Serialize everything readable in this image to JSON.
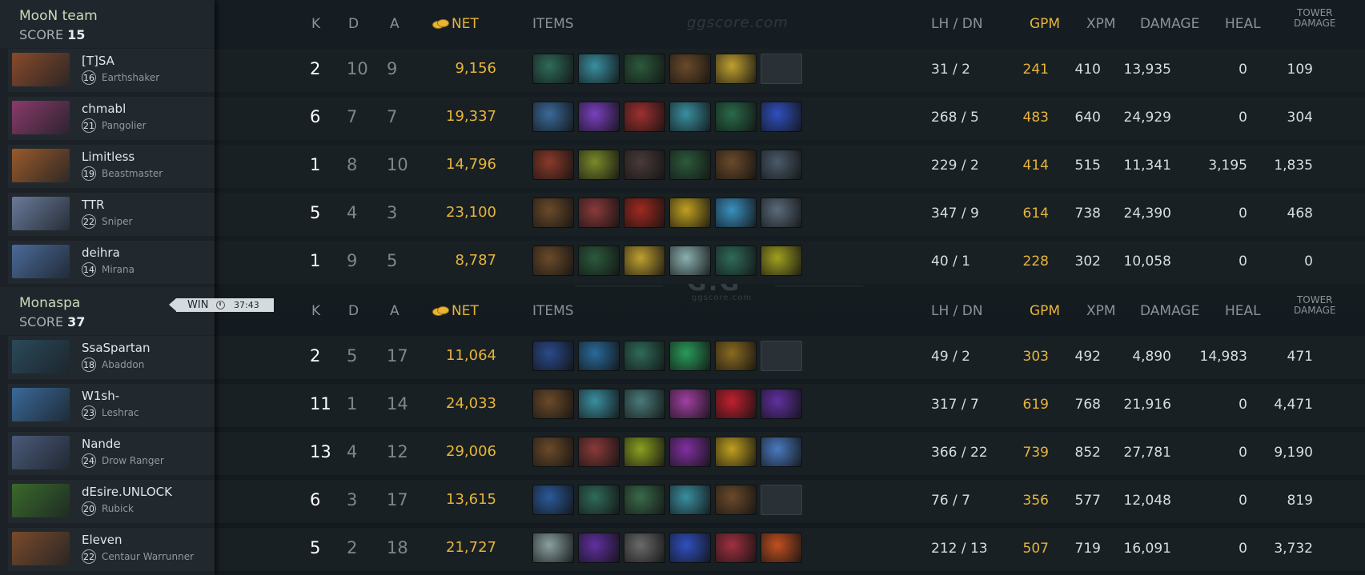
{
  "headers": {
    "k": "K",
    "d": "D",
    "a": "A",
    "net": "NET",
    "items": "ITEMS",
    "lhdn": "LH  /  DN",
    "gpm": "GPM",
    "xpm": "XPM",
    "damage": "DAMAGE",
    "heal": "HEAL",
    "tower_line1": "TOWER",
    "tower_line2": "DAMAGE"
  },
  "watermark": {
    "site": "ggscore.com",
    "logo": "G:G"
  },
  "result": {
    "label": "WIN",
    "time": "37:43"
  },
  "teams": [
    {
      "name": "MooN team",
      "score_label": "SCORE",
      "score": "15",
      "players": [
        {
          "name": "[T]SA",
          "level": "16",
          "hero": "Earthshaker",
          "k": "2",
          "d": "10",
          "a": "9",
          "net": "9,156",
          "lhdn": "31  /  2",
          "gpm": "241",
          "xpm": "410",
          "damage": "13,935",
          "heal": "0",
          "tower": "109",
          "portrait_color": "#8a4a2a",
          "items": [
            "#2f6b5a",
            "#3a8fa0",
            "#2c5a3c",
            "#6b4a2a",
            "#c0a030",
            "empty"
          ]
        },
        {
          "name": "chmabl",
          "level": "21",
          "hero": "Pangolier",
          "k": "6",
          "d": "7",
          "a": "7",
          "net": "19,337",
          "lhdn": "268  /  5",
          "gpm": "483",
          "xpm": "640",
          "damage": "24,929",
          "heal": "0",
          "tower": "304",
          "portrait_color": "#8a3a6a",
          "items": [
            "#3a6a9a",
            "#7a40c0",
            "#a03030",
            "#3a8fa0",
            "#2a6a4a",
            "#3050c0"
          ]
        },
        {
          "name": "Limitless",
          "level": "19",
          "hero": "Beastmaster",
          "k": "1",
          "d": "8",
          "a": "10",
          "net": "14,796",
          "lhdn": "229  /  2",
          "gpm": "414",
          "xpm": "515",
          "damage": "11,341",
          "heal": "3,195",
          "tower": "1,835",
          "portrait_color": "#9a5a2a",
          "items": [
            "#8a3a2a",
            "#7a8a2a",
            "#4a3a3a",
            "#2c5a3c",
            "#6b4a2a",
            "#4a5a6a"
          ]
        },
        {
          "name": "TTR",
          "level": "22",
          "hero": "Sniper",
          "k": "5",
          "d": "4",
          "a": "3",
          "net": "23,100",
          "lhdn": "347  /  9",
          "gpm": "614",
          "xpm": "738",
          "damage": "24,390",
          "heal": "0",
          "tower": "468",
          "portrait_color": "#6a7a9a",
          "items": [
            "#6b4a2a",
            "#8a3a3a",
            "#a02a20",
            "#c0a020",
            "#3a90c0",
            "#5a6a7a"
          ]
        },
        {
          "name": "deihra",
          "level": "14",
          "hero": "Mirana",
          "k": "1",
          "d": "9",
          "a": "5",
          "net": "8,787",
          "lhdn": "40  /  1",
          "gpm": "228",
          "xpm": "302",
          "damage": "10,058",
          "heal": "0",
          "tower": "0",
          "portrait_color": "#4a6a9a",
          "items": [
            "#6b4a2a",
            "#2c5a3c",
            "#c0a030",
            "#8ab0b0",
            "#2f6b5a",
            "#a0a020"
          ]
        }
      ]
    },
    {
      "name": "Monaspa",
      "score_label": "SCORE",
      "score": "37",
      "players": [
        {
          "name": "SsaSpartan",
          "level": "18",
          "hero": "Abaddon",
          "k": "2",
          "d": "5",
          "a": "17",
          "net": "11,064",
          "lhdn": "49  /  2",
          "gpm": "303",
          "xpm": "492",
          "damage": "4,890",
          "heal": "14,983",
          "tower": "471",
          "portrait_color": "#2a4a5a",
          "items": [
            "#2a4a8a",
            "#2a6a9a",
            "#2f6b5a",
            "#2a9a5a",
            "#8a6a20",
            "empty"
          ]
        },
        {
          "name": "W1sh-",
          "level": "23",
          "hero": "Leshrac",
          "k": "11",
          "d": "1",
          "a": "14",
          "net": "24,033",
          "lhdn": "317  /  7",
          "gpm": "619",
          "xpm": "768",
          "damage": "21,916",
          "heal": "0",
          "tower": "4,471",
          "portrait_color": "#3a6a9a",
          "items": [
            "#6b4a2a",
            "#3a8fa0",
            "#4a7a7a",
            "#a040a0",
            "#c02030",
            "#6030a0"
          ]
        },
        {
          "name": "Nande",
          "level": "24",
          "hero": "Drow Ranger",
          "k": "13",
          "d": "4",
          "a": "12",
          "net": "29,006",
          "lhdn": "366  /  22",
          "gpm": "739",
          "xpm": "852",
          "damage": "27,781",
          "heal": "0",
          "tower": "9,190",
          "portrait_color": "#4a5a7a",
          "items": [
            "#6b4a2a",
            "#8a3a3a",
            "#8aa020",
            "#8030a0",
            "#c0a020",
            "#4a7ac0"
          ]
        },
        {
          "name": "dEsire.UNLOCK",
          "level": "20",
          "hero": "Rubick",
          "k": "6",
          "d": "3",
          "a": "17",
          "net": "13,615",
          "lhdn": "76  /  7",
          "gpm": "356",
          "xpm": "577",
          "damage": "12,048",
          "heal": "0",
          "tower": "819",
          "portrait_color": "#3a6a2a",
          "items": [
            "#2a5a9a",
            "#2f6b5a",
            "#3a6a4a",
            "#3a8fa0",
            "#6b4a2a",
            "empty"
          ]
        },
        {
          "name": "Eleven",
          "level": "22",
          "hero": "Centaur Warrunner",
          "k": "5",
          "d": "2",
          "a": "18",
          "net": "21,727",
          "lhdn": "212  /  13",
          "gpm": "507",
          "xpm": "719",
          "damage": "16,091",
          "heal": "0",
          "tower": "3,732",
          "portrait_color": "#7a4a2a",
          "items": [
            "#8aa0a0",
            "#6030a0",
            "#6a6a6a",
            "#3050c0",
            "#a03040",
            "#c05020"
          ]
        }
      ]
    }
  ]
}
